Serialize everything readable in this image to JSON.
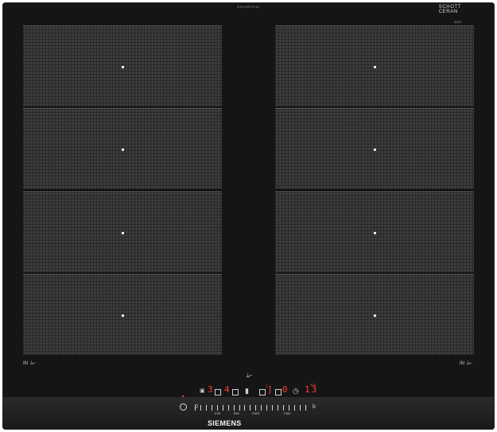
{
  "cooktop": {
    "model_code": "EX675FXC1E",
    "glass_brand_line1": "SCHOTT",
    "glass_brand_line2": "CERAN",
    "glass_code": "6203"
  },
  "zones": {
    "left": [
      {
        "name": "left-zone-1"
      },
      {
        "name": "left-zone-2"
      },
      {
        "name": "left-zone-3"
      },
      {
        "name": "left-zone-4"
      }
    ],
    "right": [
      {
        "name": "right-zone-1"
      },
      {
        "name": "right-zone-2"
      },
      {
        "name": "right-zone-3"
      },
      {
        "name": "right-zone-4"
      }
    ],
    "left_flex_label": "IN",
    "right_flex_label": "IN"
  },
  "controls": {
    "pan_icon": "pan-icon",
    "display_left_digit": "3",
    "display_mid_digit": "4",
    "display_right_digit": "0",
    "display_right_top": "1",
    "display_timer": "13",
    "timer_label": "min",
    "power_icon": "power-icon",
    "slider_zero": "0",
    "slider_end_label": "b",
    "scale_min": "min",
    "scale_low": "low",
    "scale_med": "med",
    "scale_max": "max"
  },
  "brand": {
    "logo": "SIEMENS"
  },
  "colors": {
    "glass": "#151515",
    "zone": "#3c3c3c",
    "display_red": "#ff3b2f"
  }
}
